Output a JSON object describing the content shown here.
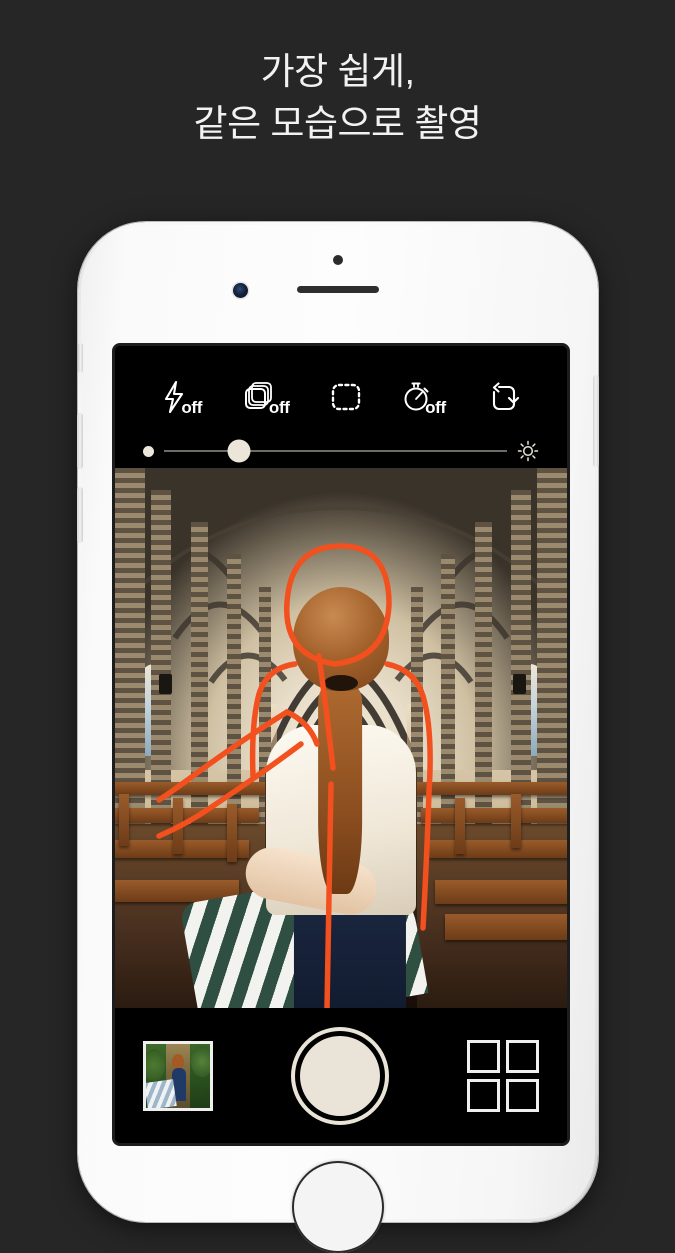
{
  "page": {
    "background_color": "#262626",
    "accent_color": "#f2501e"
  },
  "headline": {
    "line1": "가장 쉽게,",
    "line2": "같은 모습으로 촬영",
    "color": "#f2f2f2"
  },
  "device": {
    "type": "smartphone",
    "body_color": "#f7f7f7",
    "buttons": {
      "silent_switch": "silent-switch",
      "volume_up": "volume-up-button",
      "volume_down": "volume-down-button",
      "power": "power-button",
      "home": "home-button"
    },
    "hardware": {
      "front_camera": "front-camera",
      "earpiece": "earpiece-speaker",
      "proximity_sensor": "proximity-sensor"
    }
  },
  "camera_app": {
    "toolbar": [
      {
        "name": "flash-toggle",
        "icon": "flash-icon",
        "status": "off"
      },
      {
        "name": "burst-toggle",
        "icon": "burst-stack-icon",
        "status": "off"
      },
      {
        "name": "overlay-frame-toggle",
        "icon": "dashed-frame-icon",
        "status": ""
      },
      {
        "name": "timer-toggle",
        "icon": "stopwatch-icon",
        "status": "off"
      },
      {
        "name": "flip-camera",
        "icon": "camera-flip-icon",
        "status": ""
      }
    ],
    "exposure_slider": {
      "name": "exposure-slider",
      "value_percent": 22,
      "min_icon": "dot-icon",
      "max_icon": "brightness-sun-icon",
      "track_color": "#6e6b66",
      "thumb_color": "#ece6da"
    },
    "viewfinder": {
      "scene": "gothic cathedral interior with vaulted arches, stone columns and wooden pews",
      "guide_overlay": {
        "name": "ghost-outline-overlay",
        "color": "#f2501e",
        "subject": "woman seen from behind with ponytail, white top, navy skirt, outstretched arm"
      }
    },
    "bottom_bar": {
      "gallery_thumbnail": {
        "name": "gallery-thumbnail",
        "scene": "green forest path with woman in blue dress"
      },
      "shutter_button": {
        "name": "shutter-button",
        "color": "#eae4d8"
      },
      "grid_button": {
        "name": "grid-view-button",
        "tiles": 4
      }
    }
  }
}
